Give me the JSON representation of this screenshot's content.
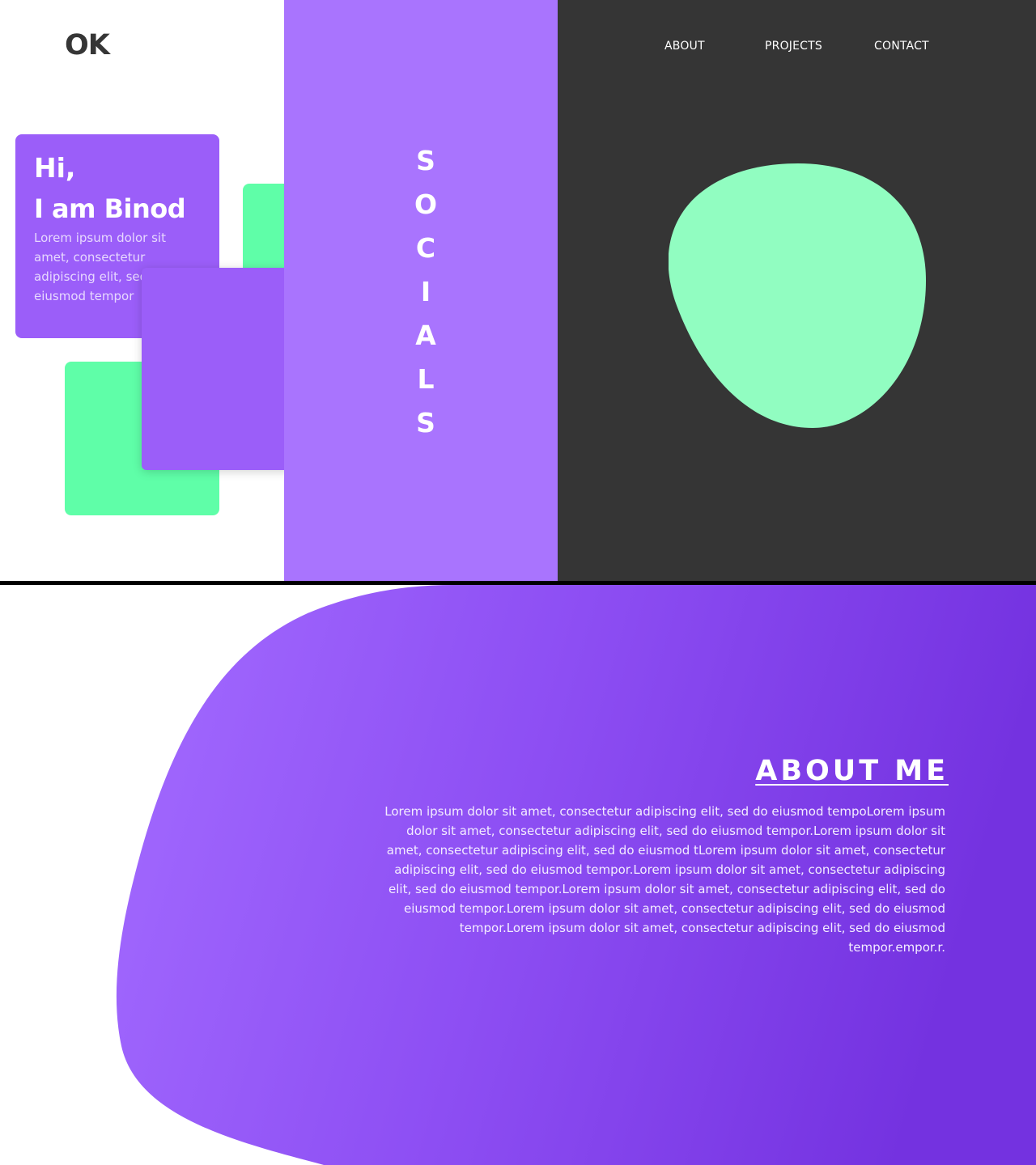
{
  "brand": {
    "logo": "OK"
  },
  "nav": {
    "items": [
      "ABOUT",
      "PROJECTS",
      "CONTACT"
    ]
  },
  "intro": {
    "greeting": "Hi,",
    "name": "I am Binod",
    "text": "Lorem ipsum dolor sit amet, consectetur adipiscing elit, sed do eiusmod tempor"
  },
  "socials": {
    "letters": [
      "S",
      "O",
      "C",
      "I",
      "A",
      "L",
      "S"
    ]
  },
  "about": {
    "title": "ABOUT ME",
    "text": "Lorem ipsum dolor sit amet, consectetur adipiscing elit, sed do eiusmod tempoLorem ipsum dolor sit amet, consectetur adipiscing elit, sed do eiusmod tempor.Lorem ipsum dolor sit amet, consectetur adipiscing elit, sed do eiusmod tLorem ipsum dolor sit amet, consectetur adipiscing elit, sed do eiusmod tempor.Lorem ipsum dolor sit amet, consectetur adipiscing elit, sed do eiusmod tempor.Lorem ipsum dolor sit amet, consectetur adipiscing elit, sed do eiusmod tempor.Lorem ipsum dolor sit amet, consectetur adipiscing elit, sed do eiusmod tempor.Lorem ipsum dolor sit amet, consectetur adipiscing elit, sed do eiusmod tempor.empor.r."
  },
  "colors": {
    "accent_purple": "#9b5ef9",
    "socials_purple": "#a974fe",
    "mint_green": "#5ffea8",
    "blob_green": "#91fdc1",
    "dark_panel": "#353535",
    "about_gradient_start": "#a36bff",
    "about_gradient_end": "#7432e0"
  }
}
